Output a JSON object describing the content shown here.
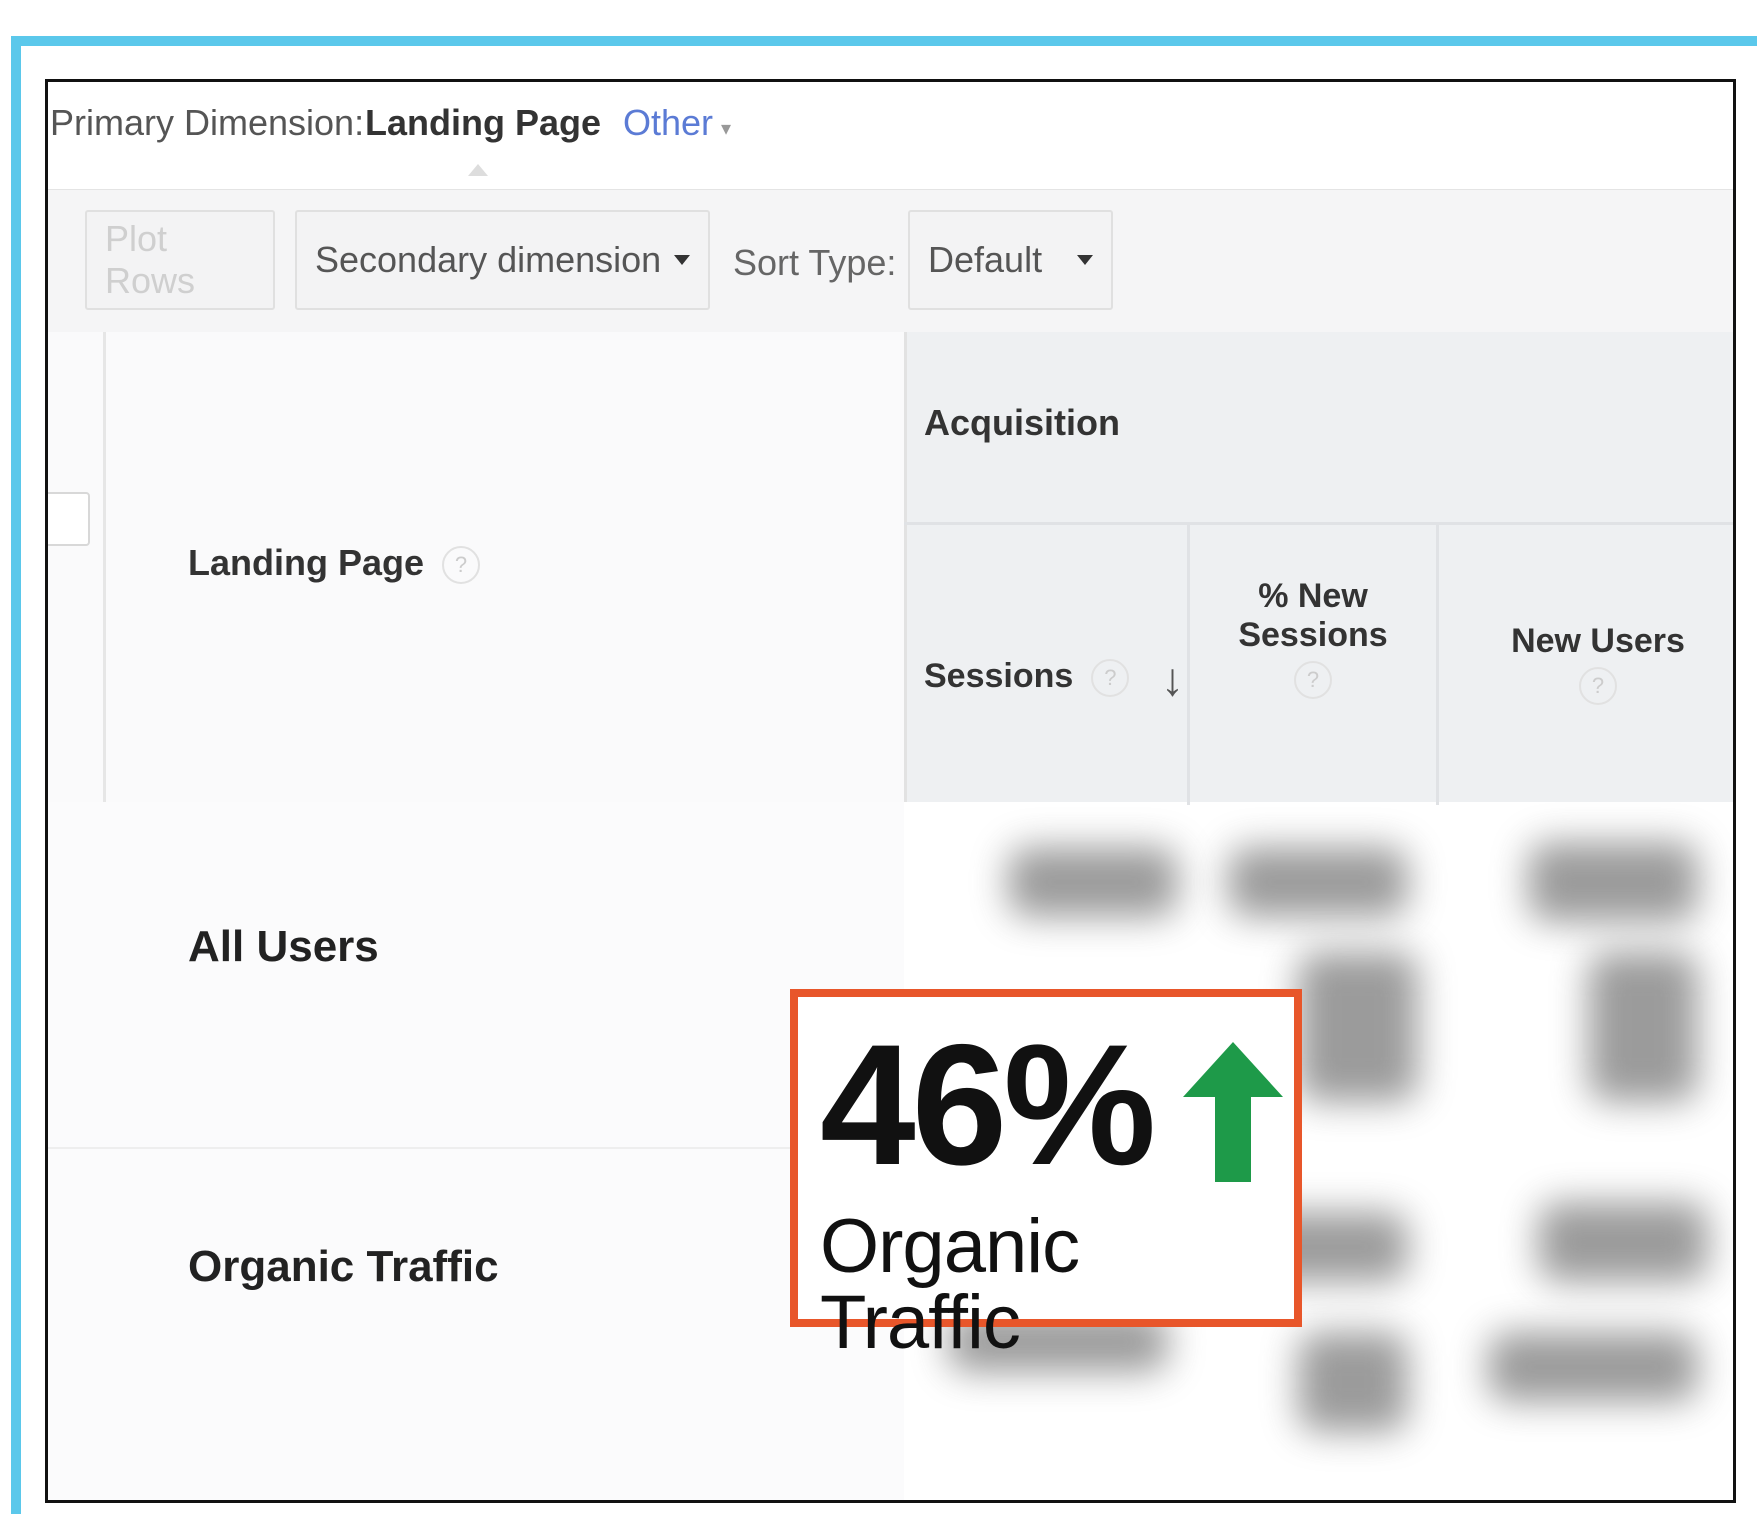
{
  "toolbar": {
    "primary_dimension_label": "Primary Dimension:",
    "primary_dimension_value": "Landing Page",
    "other_label": "Other",
    "plot_rows_label": "Plot Rows",
    "secondary_dimension_label": "Secondary dimension",
    "sort_type_label": "Sort Type:",
    "sort_type_value": "Default"
  },
  "table": {
    "landing_page_header": "Landing Page",
    "group_header": "Acquisition",
    "columns": [
      "Sessions",
      "% New Sessions",
      "New Users"
    ],
    "rows": [
      "All Users",
      "Organic Traffic"
    ]
  },
  "callout": {
    "value": "46%",
    "label": "Organic Traffic",
    "arrow_color": "#1E9A49",
    "border_color": "#E8562A"
  },
  "colors": {
    "frame": "#5BC8EB",
    "link": "#5B7BD5"
  }
}
